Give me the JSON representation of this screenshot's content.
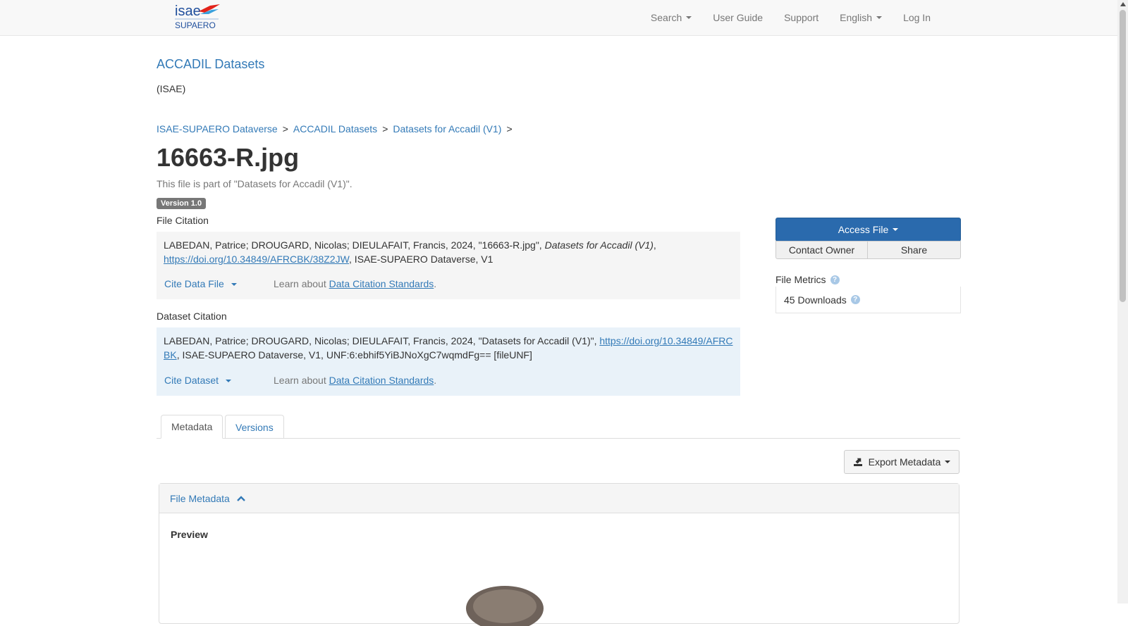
{
  "nav": {
    "logo_text_top": "isae",
    "logo_text_bottom": "SUPAERO",
    "search": "Search",
    "user_guide": "User Guide",
    "support": "Support",
    "language": "English",
    "login": "Log In"
  },
  "dataverse": {
    "name": "ACCADIL Datasets",
    "affiliation": "(ISAE)"
  },
  "breadcrumb": {
    "items": [
      "ISAE-SUPAERO Dataverse",
      "ACCADIL Datasets",
      "Datasets for Accadil (V1)"
    ],
    "separator": ">"
  },
  "file": {
    "title": "16663-R.jpg",
    "part_of": "This file is part of \"Datasets for Accadil (V1)\".",
    "version": "Version 1.0"
  },
  "file_citation": {
    "label": "File Citation",
    "text_before": "LABEDAN, Patrice; DROUGARD, Nicolas; DIEULAFAIT, Francis, 2024, \"16663-R.jpg\", ",
    "italic": "Datasets for Accadil (V1)",
    "comma": ",",
    "doi": "https://doi.org/10.34849/AFRCBK/38Z2JW",
    "text_after": ", ISAE-SUPAERO Dataverse, V1",
    "cite_button": "Cite Data File",
    "learn_prefix": "Learn about ",
    "learn_link": "Data Citation Standards",
    "learn_suffix": "."
  },
  "dataset_citation": {
    "label": "Dataset Citation",
    "text_before": "LABEDAN, Patrice; DROUGARD, Nicolas; DIEULAFAIT, Francis, 2024, \"Datasets for Accadil (V1)\", ",
    "doi": "https://doi.org/10.34849/AFRCBK",
    "text_after": ", ISAE-SUPAERO Dataverse, V1, UNF:6:ebhif5YiBJNoXgC7wqmdFg== [fileUNF]",
    "cite_button": "Cite Dataset",
    "learn_prefix": "Learn about ",
    "learn_link": "Data Citation Standards",
    "learn_suffix": "."
  },
  "actions": {
    "access_file": "Access File",
    "contact_owner": "Contact Owner",
    "share": "Share"
  },
  "metrics": {
    "label": "File Metrics",
    "downloads": "45 Downloads"
  },
  "tabs": [
    "Metadata",
    "Versions"
  ],
  "export_metadata": "Export Metadata",
  "file_metadata": {
    "heading": "File Metadata",
    "preview_label": "Preview"
  },
  "colors": {
    "link": "#337ab7",
    "primary_button": "#2a6aad",
    "file_citation_bg": "#f5f5f5",
    "dataset_citation_bg": "#e9f2f9"
  },
  "icons": [
    "caret-down-icon",
    "help-icon",
    "export-icon",
    "chevron-up-icon"
  ]
}
